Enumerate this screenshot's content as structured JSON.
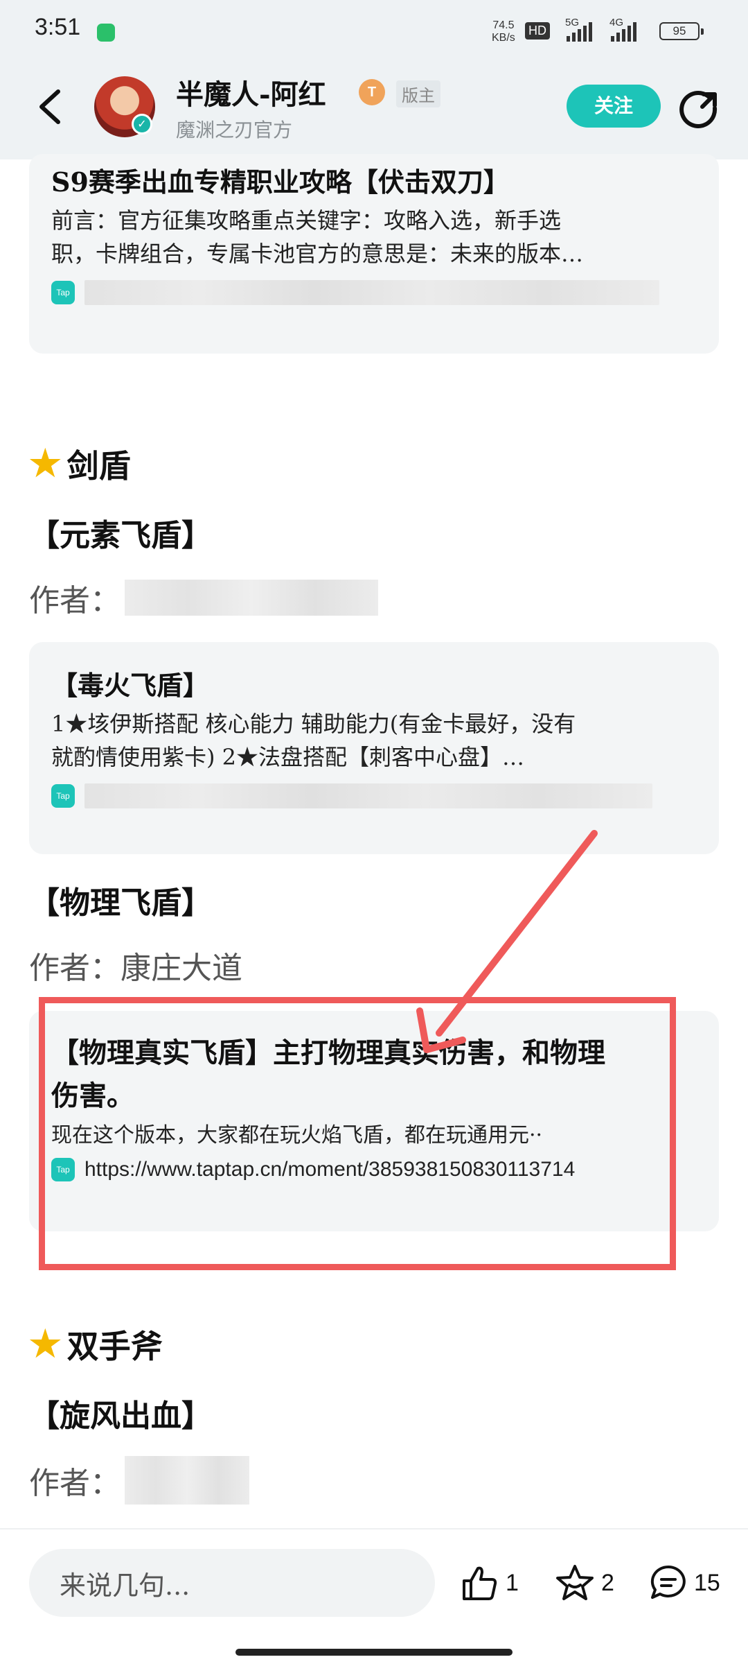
{
  "status": {
    "time": "3:51",
    "net_speed_value": "74.5",
    "net_speed_unit": "KB/s",
    "hd_label": "HD",
    "sig1_label": "5G",
    "sig2_label": "4G",
    "battery": "95"
  },
  "header": {
    "author_name": "半魔人-阿红",
    "level": "T",
    "role": "版主",
    "subtitle": "魔渊之刃官方",
    "follow_label": "关注"
  },
  "colors": {
    "accent": "#1dc4b8",
    "annotation": "#ef5a5a",
    "star": "#f5b800"
  },
  "top_card": {
    "title": "S9赛季出血专精职业攻略【伏击双刀】",
    "desc_line1": "前言：官方征集攻略重点关键字：攻略入选，新手选",
    "desc_line2": "职，卡牌组合，专属卡池官方的意思是：未来的版本…",
    "icon_label": "Tap"
  },
  "section_sword": {
    "star_icon": "star-icon",
    "title": "剑盾",
    "sub1": "【元素飞盾】",
    "author_prefix": "作者：",
    "card": {
      "title": "【毒火飞盾】",
      "desc_line1": "1★垓伊斯搭配 核心能力 辅助能力(有金卡最好，没有",
      "desc_line2": "就酌情使用紫卡) 2★法盘搭配【刺客中心盘】…",
      "icon_label": "Tap"
    },
    "sub2": "【物理飞盾】",
    "author2": "康庄大道",
    "card2": {
      "title_line1": "【物理真实飞盾】主打物理真实伤害，和物理",
      "title_line2": "伤害。",
      "desc": "现在这个版本，大家都在玩火焰飞盾，都在玩通用元··",
      "icon_label": "Tap",
      "url": "https://www.taptap.cn/moment/385938150830113714"
    }
  },
  "section_axe": {
    "title": "双手斧",
    "sub1": "【旋风出血】",
    "author_prefix": "作者："
  },
  "bottom": {
    "comment_placeholder": "来说几句...",
    "likes": "1",
    "favorites": "2",
    "comments": "15"
  }
}
